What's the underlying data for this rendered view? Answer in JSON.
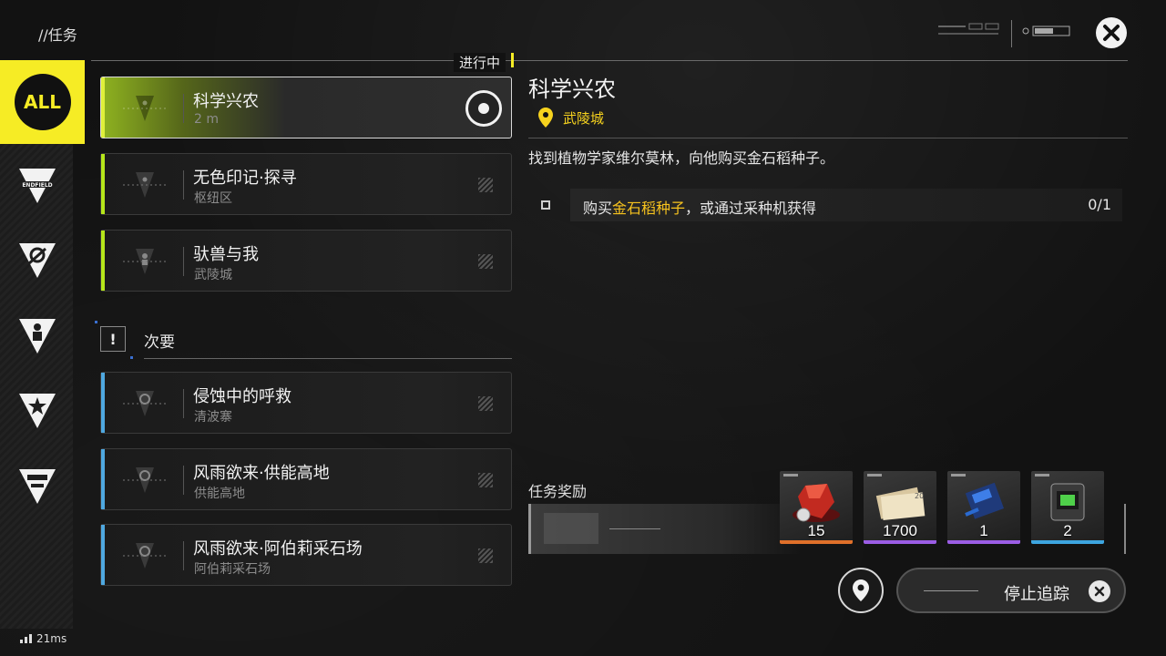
{
  "header": {
    "title": "//任务",
    "status_label": "进行中"
  },
  "sidebar": {
    "items": [
      {
        "label": "ALL",
        "icon": "all-filter-icon",
        "active": true
      },
      {
        "label": "",
        "icon": "endfield-icon"
      },
      {
        "label": "",
        "icon": "slash-triangle-icon"
      },
      {
        "label": "",
        "icon": "person-triangle-icon"
      },
      {
        "label": "",
        "icon": "star-triangle-icon"
      },
      {
        "label": "",
        "icon": "gate-triangle-icon"
      }
    ]
  },
  "main_quests": [
    {
      "title": "科学兴农",
      "subtitle": "2 m",
      "selected": true,
      "accent": "#b6e61a"
    },
    {
      "title": "无色印记·探寻",
      "subtitle": "枢纽区",
      "selected": false,
      "accent": "#b6e61a"
    },
    {
      "title": "驮兽与我",
      "subtitle": "武陵城",
      "selected": false,
      "accent": "#b6e61a"
    }
  ],
  "secondary": {
    "label": "次要",
    "icon_text": "!",
    "quests": [
      {
        "title": "侵蚀中的呼救",
        "subtitle": "清波寨",
        "accent": "#4fa8e0"
      },
      {
        "title": "风雨欲来·供能高地",
        "subtitle": "供能高地",
        "accent": "#4fa8e0"
      },
      {
        "title": "风雨欲来·阿伯莉采石场",
        "subtitle": "阿伯莉采石场",
        "accent": "#4fa8e0"
      }
    ]
  },
  "detail": {
    "title": "科学兴农",
    "location": "武陵城",
    "description": "找到植物学家维尔莫林，向他购买金石稻种子。",
    "objective": {
      "prefix": "购买",
      "highlight": "金石稻种子",
      "suffix": "，或通过采种机获得",
      "progress": "0/1"
    },
    "rewards_label": "任务奖励",
    "rewards": [
      {
        "qty": "15",
        "rarity_color": "#e0702a",
        "icon": "red-crystal-icon"
      },
      {
        "qty": "1700",
        "rarity_color": "#9b5de5",
        "icon": "currency-notes-icon"
      },
      {
        "qty": "1",
        "rarity_color": "#9b5de5",
        "icon": "blue-component-icon"
      },
      {
        "qty": "2",
        "rarity_color": "#3da5e0",
        "icon": "green-module-icon"
      }
    ]
  },
  "buttons": {
    "stop_tracking": "停止追踪"
  },
  "status_bar": {
    "ping": "21ms"
  },
  "colors": {
    "accent_yellow": "#f6ec25",
    "main_quest": "#b6e61a",
    "side_quest": "#4fa8e0",
    "highlight_text": "#f6c21e"
  }
}
